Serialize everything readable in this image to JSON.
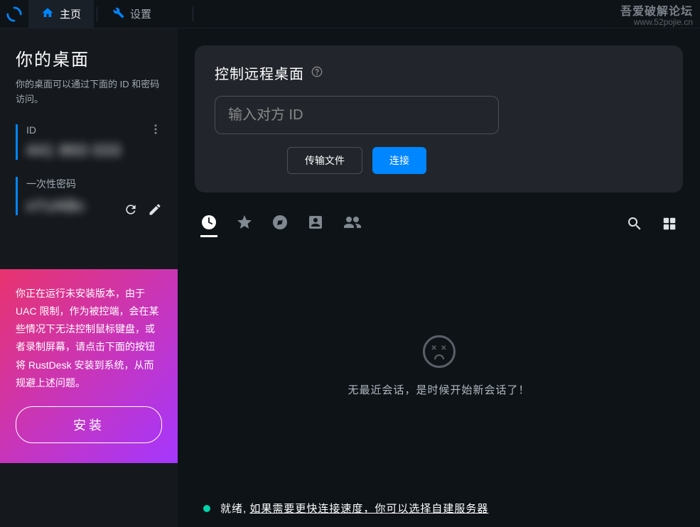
{
  "nav": {
    "home_label": "主页",
    "settings_label": "设置"
  },
  "watermark": {
    "title": "吾爱破解论坛",
    "url": "www.52pojie.cn"
  },
  "sidebar": {
    "desktop_title": "你的桌面",
    "desktop_sub": "你的桌面可以通过下面的 ID 和密码访问。",
    "id_label": "ID",
    "id_value": "441 893 033",
    "pwd_label": "一次性密码",
    "pwd_value": "xYzABc"
  },
  "install": {
    "text": "你正在运行未安装版本，由于 UAC 限制，作为被控端，会在某些情况下无法控制鼠标键盘，或者录制屏幕，请点击下面的按钮将 RustDesk 安装到系统，从而规避上述问题。",
    "button": "安装"
  },
  "remote": {
    "title": "控制远程桌面",
    "placeholder": "输入对方 ID",
    "transfer_btn": "传输文件",
    "connect_btn": "连接"
  },
  "empty": {
    "text": "无最近会话，是时候开始新会话了！"
  },
  "status": {
    "ready": "就绪,",
    "link": "如果需要更快连接速度，你可以选择自建服务器"
  }
}
